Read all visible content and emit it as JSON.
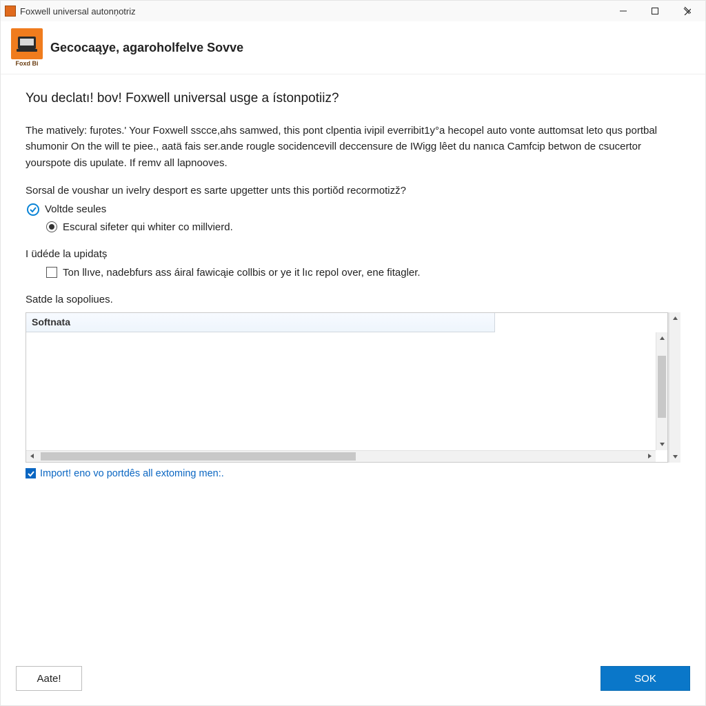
{
  "window": {
    "title": "Foxwell universal autonņotriz"
  },
  "header": {
    "brand_caption": "Foxd Bi",
    "title": "Gecocaąye, agaroholfelve Sovve"
  },
  "main": {
    "heading": "You declatı! bov! Foxwell universal usge a ístonpotiiz?",
    "paragraph": "The matively: fuŗotes.' Your Foxwell sscce,ahs samwed, this pont clpentia ivipil everribit1y°a hecopel auto vonte auttomsat leto qus portbal shumonir On the will te piee., aatä fais ser.ande rougle socidencevill deccensure de IWigg lêet du nanıca Camfcip betwon de csucertor yourspote dis upulate. If remv all lapnooves.",
    "subquestion": "Sorsal de voushar un ivelry desport es sarte upgetter unts this portiŏd recormotizž?",
    "option1_label": "Voltde seules",
    "option2_label": "Escural sifeter qui whiter co millvierd.",
    "section2_label": "I üdéde la upidatș",
    "checkbox1_label": "Ton llıve, nadebfurs ass áiral fawicąie collbis or ye it lıc repol over, ene fitagler.",
    "section3_label": "Satde la sopoliues.",
    "list_header": "Softnata",
    "import_label": "Import! eno vo portdês all extoming men:."
  },
  "footer": {
    "secondary_label": "Aate!",
    "primary_label": "SOK"
  },
  "icons": {
    "minimize": "minimize",
    "maximize": "maximize",
    "close": "close"
  }
}
